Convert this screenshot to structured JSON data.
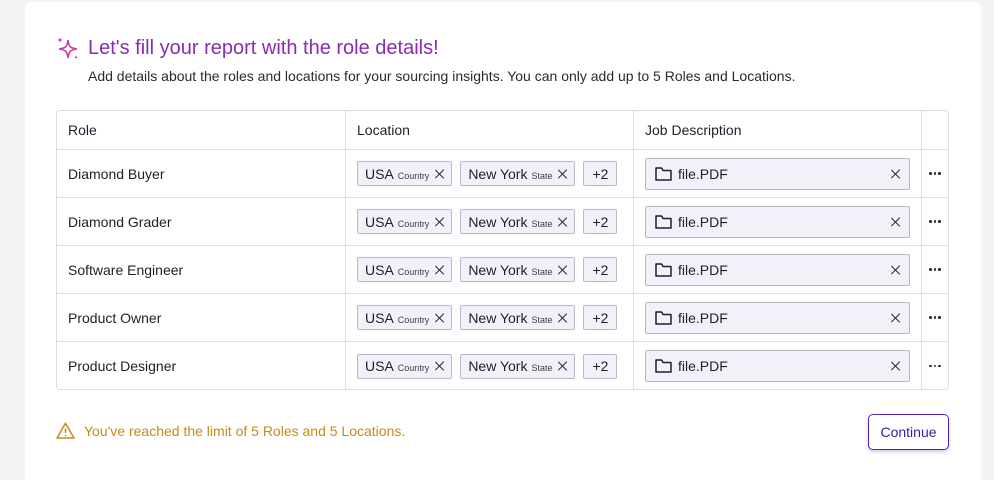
{
  "header": {
    "title": "Let's fill your report with the role details!",
    "subtitle": "Add details about the roles and locations for your sourcing insights. You can only add up to 5 Roles and Locations."
  },
  "table": {
    "columns": [
      "Role",
      "Location",
      "Job Description"
    ],
    "rows": [
      {
        "role": "Diamond Buyer",
        "country": "USA",
        "country_sub": "Country",
        "state": "New York",
        "state_sub": "State",
        "more": "+2",
        "file": "file.PDF"
      },
      {
        "role": "Diamond Grader",
        "country": "USA",
        "country_sub": "Country",
        "state": "New York",
        "state_sub": "State",
        "more": "+2",
        "file": "file.PDF"
      },
      {
        "role": "Software Engineer",
        "country": "USA",
        "country_sub": "Country",
        "state": "New York",
        "state_sub": "State",
        "more": "+2",
        "file": "file.PDF"
      },
      {
        "role": "Product Owner",
        "country": "USA",
        "country_sub": "Country",
        "state": "New York",
        "state_sub": "State",
        "more": "+2",
        "file": "file.PDF"
      },
      {
        "role": "Product Designer",
        "country": "USA",
        "country_sub": "Country",
        "state": "New York",
        "state_sub": "State",
        "more": "+2",
        "file": "file.PDF"
      }
    ]
  },
  "footer": {
    "warning": "You've reached the limit of 5 Roles and 5 Locations.",
    "continue_label": "Continue"
  },
  "colors": {
    "title": "#8a2bb5",
    "warning": "#c98a15",
    "button": "#3f19a3"
  },
  "icons": [
    "sparkle-icon",
    "close-icon",
    "folder-icon",
    "more-horizontal-icon",
    "warning-icon"
  ]
}
